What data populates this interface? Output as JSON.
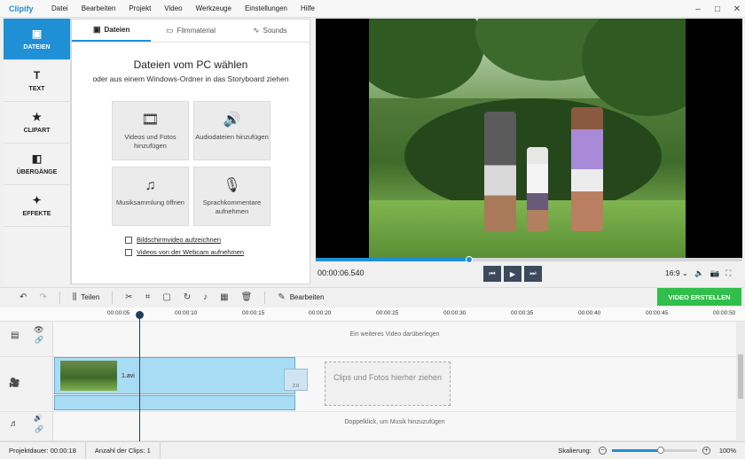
{
  "app": {
    "logo": "Clipify"
  },
  "menu": [
    "Datei",
    "Bearbeiten",
    "Projekt",
    "Video",
    "Werkzeuge",
    "Einstellungen",
    "Hilfe"
  ],
  "window_controls": [
    "–",
    "□",
    "✕"
  ],
  "sidebar": {
    "items": [
      {
        "label": "DATEIEN",
        "icon": "image-icon",
        "glyph": "▣",
        "active": true
      },
      {
        "label": "TEXT",
        "icon": "text-icon",
        "glyph": "T",
        "active": false
      },
      {
        "label": "CLIPART",
        "icon": "star-icon",
        "glyph": "★",
        "active": false
      },
      {
        "label": "ÜBERGÄNGE",
        "icon": "transitions-icon",
        "glyph": "◧",
        "active": false
      },
      {
        "label": "EFFEKTE",
        "icon": "magic-wand-icon",
        "glyph": "✦",
        "active": false
      }
    ]
  },
  "tabs": [
    {
      "label": "Dateien",
      "glyph": "▣",
      "active": true
    },
    {
      "label": "Filmmaterial",
      "glyph": "▭",
      "active": false
    },
    {
      "label": "Sounds",
      "glyph": "∿",
      "active": false
    }
  ],
  "files": {
    "title": "Dateien vom PC wählen",
    "subtitle": "oder aus einem Windows-Ordner in das Storyboard ziehen",
    "tiles": [
      {
        "label": "Videos und Fotos hinzufügen",
        "glyph": "🎞"
      },
      {
        "label": "Audiodateien hinzufügen",
        "glyph": "🔊"
      },
      {
        "label": "Musiksammlung öffnen",
        "glyph": "♫"
      },
      {
        "label": "Sprachkommentare aufnehmen",
        "glyph": "🎙"
      }
    ],
    "links": [
      "Bildschirmvideo aufzeichnen",
      "Videos von der Webcam aufnehmen"
    ]
  },
  "player": {
    "timecode": "00:00:06.540",
    "progress": 0.36,
    "aspect": "16:9 ⌄",
    "buttons": [
      "⏮",
      "▶",
      "⏭"
    ],
    "icons": [
      "speaker-icon",
      "camera-icon",
      "fullscreen-icon"
    ]
  },
  "toolbar": {
    "split_label": "Teilen",
    "edit_label": "Bearbeiten",
    "export_label": "VIDEO ERSTELLEN"
  },
  "ruler": {
    "ticks": [
      "00:00:05",
      "00:00:10",
      "00:00:15",
      "00:00:20",
      "00:00:25",
      "00:00:30",
      "00:00:35",
      "00:00:40",
      "00:00:45",
      "00:00:50"
    ]
  },
  "timeline": {
    "overlay_hint": "Ein weiteres Video darüberlegen",
    "clip_name": "1.avi",
    "transition_label": "2.0",
    "dropzone": "Clips und Fotos hierher ziehen",
    "music_hint": "Doppelklick, um Musik hinzuzufügen"
  },
  "status": {
    "duration": "Projektdauer:   00:00:18",
    "clips": "Anzahl der Clips: 1",
    "zoom_label": "Skalierung:",
    "zoom_value": "100%",
    "zoom_level": 0.58
  },
  "colors": {
    "accent": "#1f8fd6",
    "export": "#2fbf4a",
    "clip": "#a8dcf5"
  }
}
